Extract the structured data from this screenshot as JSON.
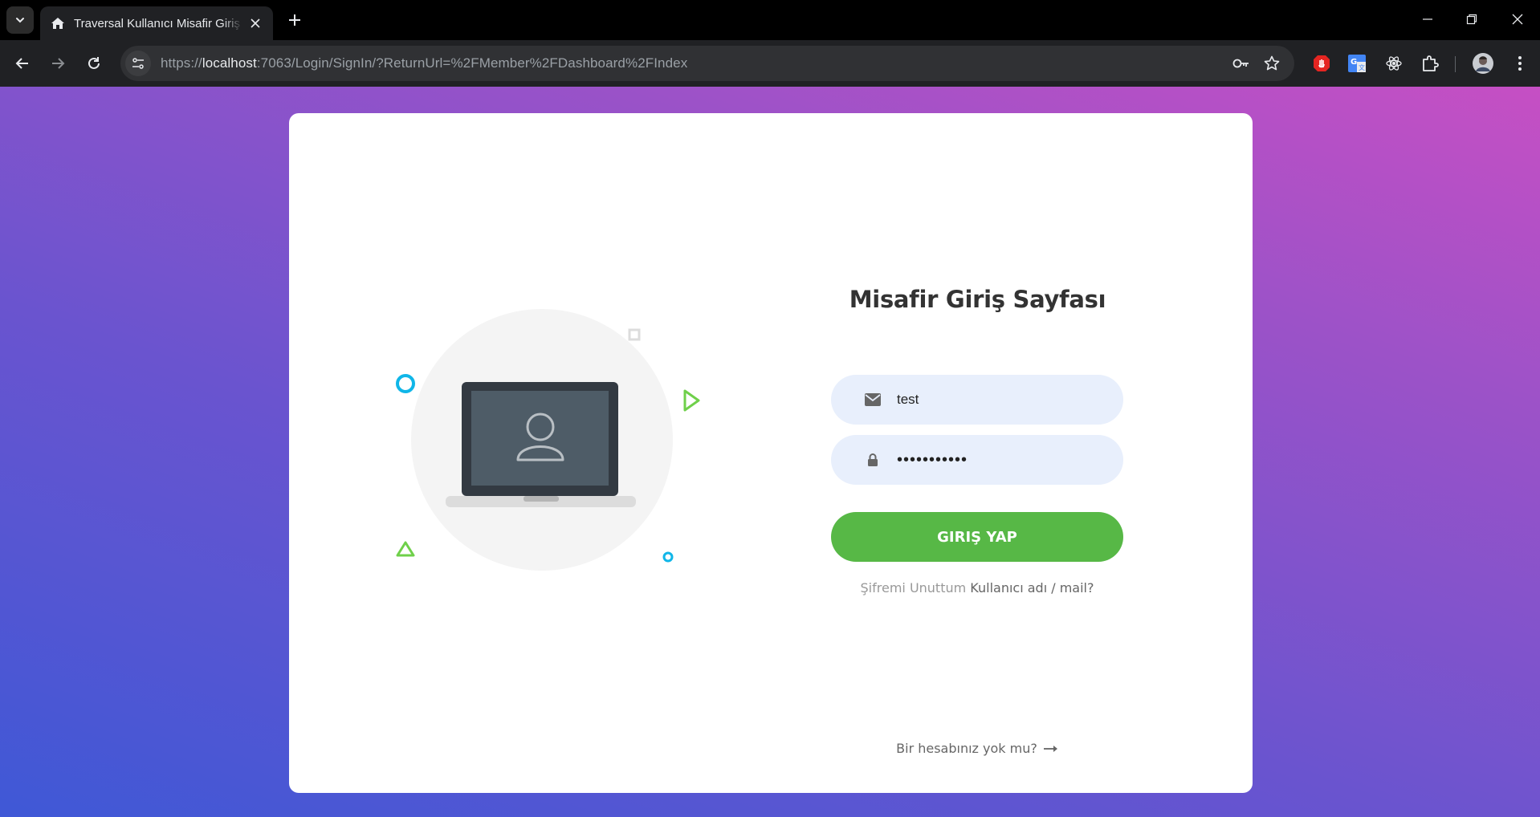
{
  "browser": {
    "tab_title": "Traversal Kullanıcı Misafir Giriş Ekranı",
    "url_prefix": "https://",
    "url_host": "localhost",
    "url_rest": ":7063/Login/SignIn/?ReturnUrl=%2FMember%2FDashboard%2FIndex",
    "icons": [
      "chevron-down-icon",
      "home-icon",
      "close-icon",
      "plus-icon",
      "minimize-icon",
      "restore-icon",
      "back-icon",
      "forward-icon",
      "reload-icon",
      "site-info-icon",
      "key-icon",
      "star-icon",
      "extension-red-icon",
      "translate-icon",
      "react-icon",
      "puzzle-icon",
      "profile-avatar",
      "more-icon"
    ]
  },
  "login": {
    "title": "Misafir Giriş Sayfası",
    "username_value": "test",
    "password_value": "•••••••••••",
    "submit_label": "GIRIŞ YAP",
    "forgot_muted": "Şifremi Unuttum",
    "forgot_link": "Kullanıcı adı / mail?",
    "signup_text": "Bir hesabınız yok mu?"
  },
  "colors": {
    "accent_green": "#57b846",
    "field_bg": "#e8effc",
    "bg_gradient_start": "#3f58d6",
    "bg_gradient_end": "#c64fc4"
  }
}
